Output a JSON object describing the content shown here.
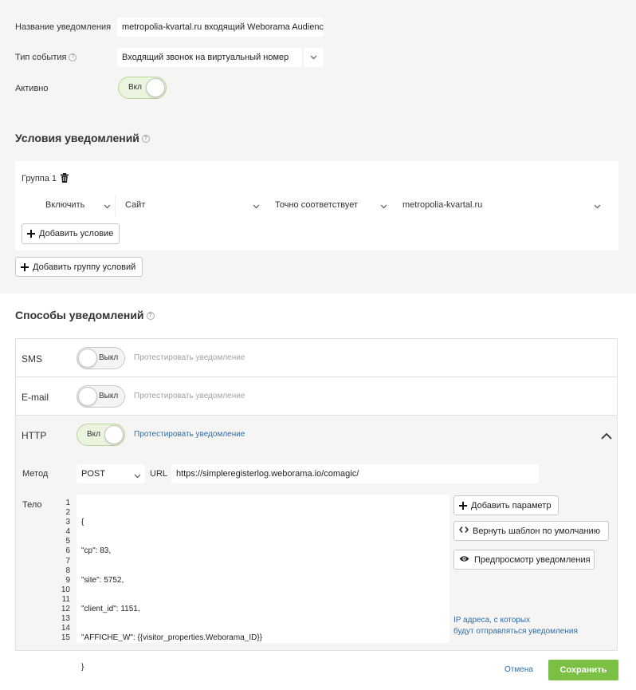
{
  "form": {
    "name_label": "Название уведомления",
    "name_value": "metropolia-kvartal.ru входящий Weborama Audience",
    "event_label": "Тип события",
    "event_value": "Входящий звонок на виртуальный номер",
    "active_label": "Активно",
    "active_toggle": "Вкл"
  },
  "conditions": {
    "title": "Условия уведомлений",
    "group_label": "Группа 1",
    "row": {
      "include": "Включить",
      "field": "Сайт",
      "operator": "Точно соответствует",
      "value": "metropolia-kvartal.ru"
    },
    "add_condition": "Добавить условие",
    "add_group": "Добавить группу условий"
  },
  "methods": {
    "title": "Способы уведомлений",
    "test_label": "Протестировать уведомление",
    "sms": {
      "label": "SMS",
      "toggle": "Выкл"
    },
    "email": {
      "label": "E-mail",
      "toggle": "Выкл"
    },
    "http": {
      "label": "HTTP",
      "toggle": "Вкл"
    }
  },
  "http": {
    "method_label": "Метод",
    "method_value": "POST",
    "url_label": "URL",
    "url_value": "https://simpleregisterlog.weborama.io/comagic/",
    "body_label": "Тело",
    "line_numbers": [
      "1",
      "2",
      "3",
      "4",
      "5",
      "6",
      "7",
      "8",
      "9",
      "10",
      "11",
      "12",
      "13",
      "14",
      "15"
    ],
    "body_lines": [
      "{",
      "\"cp\": 83,",
      "\"site\": 5752,",
      "\"client_id\": 1151,",
      "\"AFFICHE_W\": {{visitor_properties.Weborama_ID}}",
      "}"
    ],
    "add_param": "Добавить параметр",
    "reset_template": "Вернуть шаблон по умолчанию",
    "preview": "Предпросмотр уведомления",
    "ip_note_line1": "IP адреса, с которых",
    "ip_note_line2": "будут отправляться уведомления"
  },
  "footer": {
    "cancel": "Отмена",
    "save": "Сохранить"
  },
  "colors": {
    "accent_green": "#7ac143",
    "link_blue": "#2e6ea6",
    "panel_bg": "#f6f5f3"
  },
  "icons": [
    "help-icon",
    "trash-icon",
    "plus-icon",
    "chevron-down-icon",
    "chevron-up-icon",
    "code-icon",
    "eye-icon"
  ]
}
